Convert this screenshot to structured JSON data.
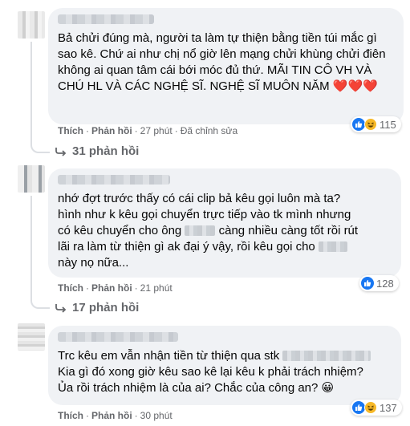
{
  "comments": [
    {
      "text": "Bả chửi đúng mà, người ta làm tự thiện bằng tiền túi mắc gì sao kê. Chứ ai như chị nổ giờ lên mạng chửi khùng chửi điên không ai quan tâm cái bới móc đủ thứ. MÃI TIN CÔ VH VÀ CHÚ HL VÀ CÁC NGHỆ SĨ. NGHỆ SĨ MUÔN NĂM",
      "emoji": "❤️❤️❤️",
      "like_label": "Thích",
      "reply_label": "Phản hồi",
      "time": "27 phút",
      "edited": "Đã chỉnh sửa",
      "reaction_count": "115",
      "replies": "31 phản hồi"
    },
    {
      "line1": "nhớ đợt trước thấy có cái clip bả kêu gọi luôn mà ta?",
      "line2": "hình như k kêu gọi chuyển trực tiếp vào tk mình nhưng",
      "line3a": "có kêu chuyển cho ông",
      "line3b": "càng nhiều càng tốt rồi rút",
      "line4": "lãi ra làm từ thiện gì ak đại ý vậy, rồi kêu gọi cho",
      "line5": "này nọ nữa...",
      "like_label": "Thích",
      "reply_label": "Phản hồi",
      "time": "21 phút",
      "reaction_count": "128",
      "replies": "17 phản hồi"
    },
    {
      "line1": "Trc kêu em vẫn nhận tiền từ thiện qua stk",
      "line2": "Kia gì đó xong giờ kêu sao kê lại kêu k phải trách nhiệm?",
      "line3": "Ủa rồi trách nhiệm là của ai? Chắc của công an?",
      "emoji": "😀",
      "like_label": "Thích",
      "reply_label": "Phản hồi",
      "time": "30 phút",
      "reaction_count": "137"
    }
  ]
}
